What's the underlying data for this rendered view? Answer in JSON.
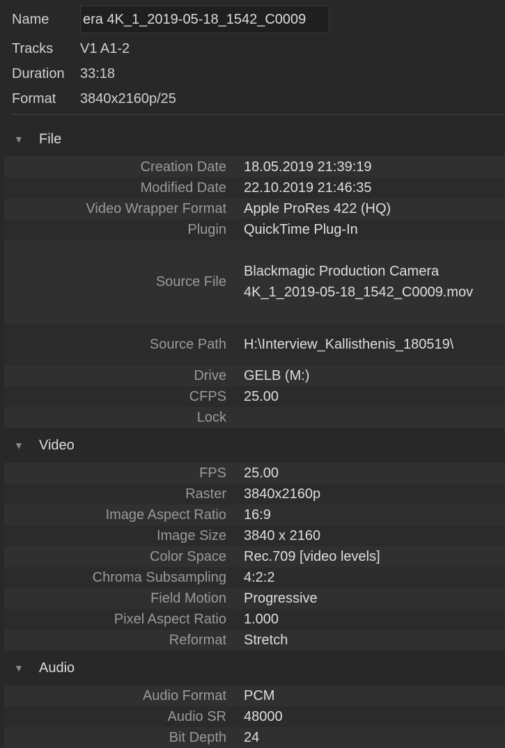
{
  "header": {
    "name_label": "Name",
    "name_value": "era 4K_1_2019-05-18_1542_C0009",
    "tracks_label": "Tracks",
    "tracks_value": "V1 A1-2",
    "duration_label": "Duration",
    "duration_value": "33:18",
    "format_label": "Format",
    "format_value": "3840x2160p/25"
  },
  "sections": [
    {
      "title": "File",
      "rows": [
        {
          "label": "Creation Date",
          "value": "18.05.2019 21:39:19"
        },
        {
          "label": "Modified Date",
          "value": "22.10.2019 21:46:35"
        },
        {
          "label": "Video Wrapper Format",
          "value": "Apple ProRes 422 (HQ)"
        },
        {
          "label": "Plugin",
          "value": "QuickTime Plug-In"
        },
        {
          "label": "Source File",
          "value": "Blackmagic Production Camera\n4K_1_2019-05-18_1542_C0009.mov",
          "tall": 4
        },
        {
          "label": "Source Path",
          "value": "H:\\Interview_Kallisthenis_180519\\",
          "tall": 2
        },
        {
          "label": "Drive",
          "value": "GELB (M:)"
        },
        {
          "label": "CFPS",
          "value": "25.00"
        },
        {
          "label": "Lock",
          "value": ""
        }
      ]
    },
    {
      "title": "Video",
      "rows": [
        {
          "label": "FPS",
          "value": "25.00"
        },
        {
          "label": "Raster",
          "value": "3840x2160p"
        },
        {
          "label": "Image Aspect Ratio",
          "value": "16:9"
        },
        {
          "label": "Image Size",
          "value": "3840 x 2160"
        },
        {
          "label": "Color Space",
          "value": "Rec.709 [video levels]"
        },
        {
          "label": "Chroma Subsampling",
          "value": "4:2:2"
        },
        {
          "label": "Field Motion",
          "value": "Progressive"
        },
        {
          "label": "Pixel Aspect Ratio",
          "value": "1.000"
        },
        {
          "label": "Reformat",
          "value": "Stretch"
        }
      ]
    },
    {
      "title": "Audio",
      "rows": [
        {
          "label": "Audio Format",
          "value": "PCM"
        },
        {
          "label": "Audio SR",
          "value": "48000"
        },
        {
          "label": "Bit Depth",
          "value": "24"
        }
      ]
    }
  ],
  "icons": {
    "collapse": "triangle-down-icon"
  }
}
